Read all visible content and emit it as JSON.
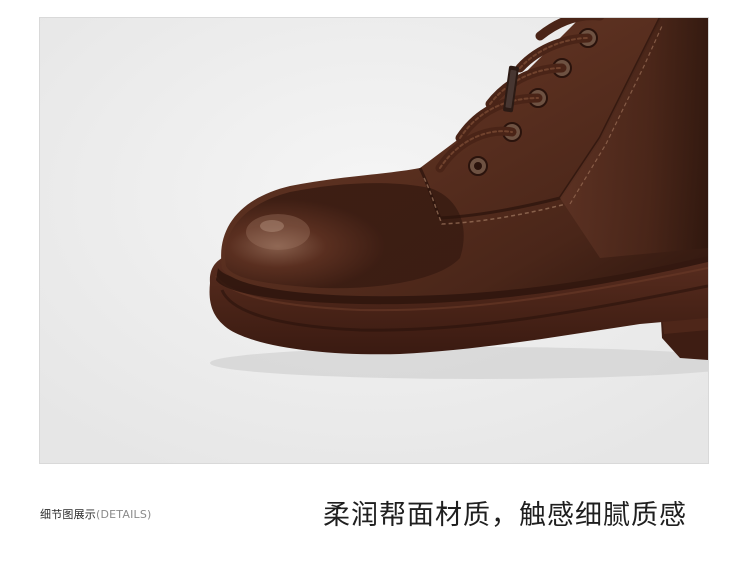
{
  "image": {
    "subject": "boot-detail-icon"
  },
  "caption": {
    "section_label_cn": "细节图展示",
    "section_label_en": "(DETAILS)",
    "headline": "柔润帮面材质，触感细腻质感"
  },
  "colors": {
    "background": "#efefef",
    "leather_dark": "#3a1d12",
    "leather_mid": "#5a2f1f",
    "leather_highlight": "#8a5a44",
    "sole": "#4a2418",
    "text_dark": "#1f1f1f",
    "text_muted": "#8a8a8a"
  }
}
